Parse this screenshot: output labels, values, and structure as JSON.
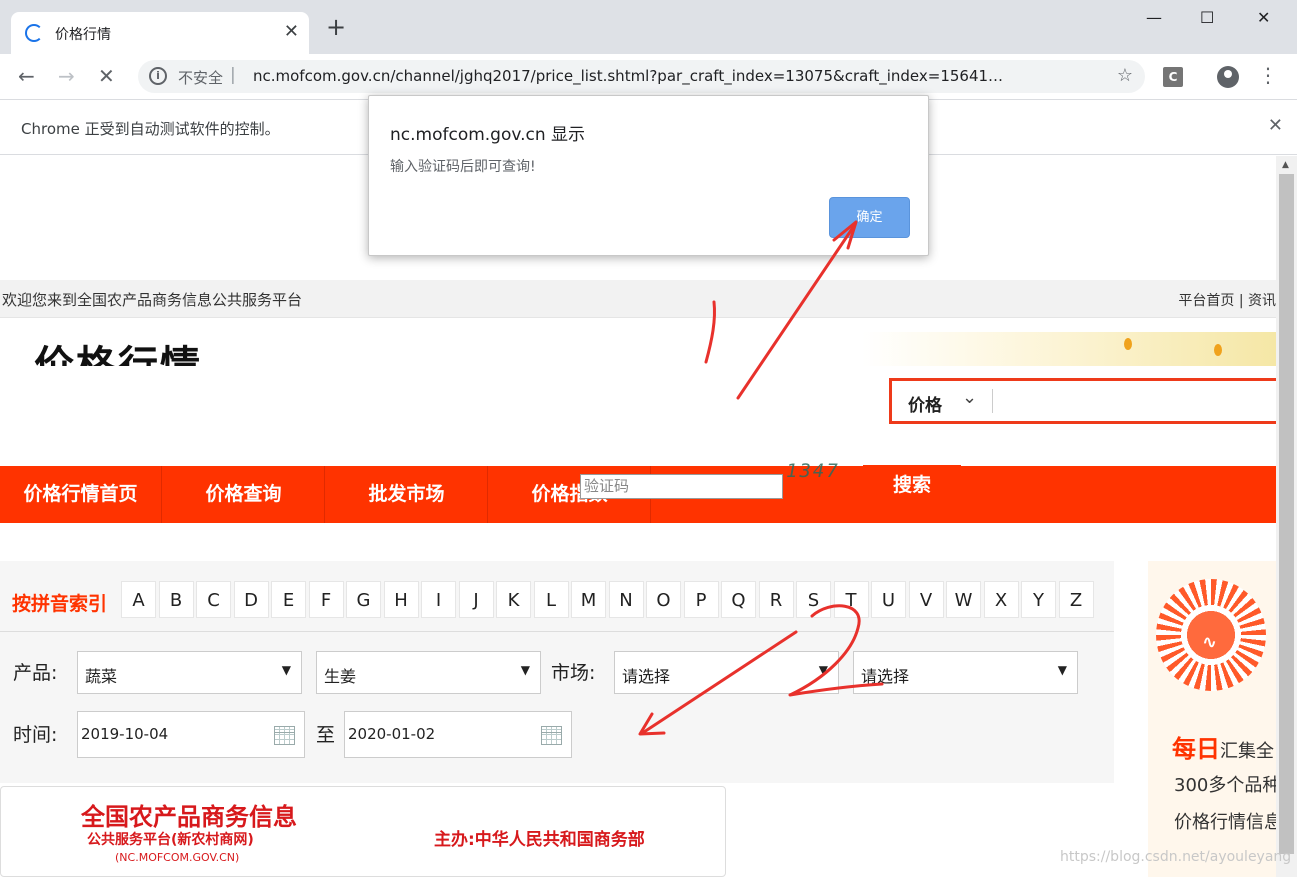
{
  "browser": {
    "tab_title": "价格行情",
    "new_tab": "+",
    "window_controls": {
      "minimize": "—",
      "maximize": "☐",
      "close": "✕"
    },
    "security_label": "不安全",
    "url": "nc.mofcom.gov.cn/channel/jghq2017/price_list.shtml?par_craft_index=13075&craft_index=15641…",
    "extension_letter": "C",
    "infobar_text": "Chrome 正受到自动测试软件的控制。"
  },
  "dialog": {
    "title": "nc.mofcom.gov.cn 显示",
    "message": "输入验证码后即可查询!",
    "ok_label": "确定"
  },
  "site": {
    "welcome": "欢迎您来到全国农产品商务信息公共服务平台",
    "top_links": "平台首页 | 资讯",
    "page_title": "价格行情",
    "search_type": "价格",
    "nav": [
      "价格行情首页",
      "价格查询",
      "批发市场",
      "价格指数"
    ]
  },
  "filter": {
    "pinyin_label": "按拼音索引",
    "letters": [
      "A",
      "B",
      "C",
      "D",
      "E",
      "F",
      "G",
      "H",
      "I",
      "J",
      "K",
      "L",
      "M",
      "N",
      "O",
      "P",
      "Q",
      "R",
      "S",
      "T",
      "U",
      "V",
      "W",
      "X",
      "Y",
      "Z"
    ],
    "product_label": "产品:",
    "product_category": "蔬菜",
    "product_item": "生姜",
    "market_label": "市场:",
    "market_region": "请选择",
    "market_name": "请选择",
    "time_label": "时间:",
    "date_from": "2019-10-04",
    "to_label": "至",
    "date_to": "2020-01-02",
    "captcha_placeholder": "验证码",
    "captcha_code": "1347",
    "search_label": "搜索"
  },
  "footer_logo": {
    "title": "全国农产品商务信息",
    "subtitle": "公共服务平台(新农村商网)",
    "domain": "(NC.MOFCOM.GOV.CN)",
    "host": "主办:中华人民共和国商务部"
  },
  "side": {
    "daily": "每日",
    "daily_rest": "汇集全",
    "line2": "300多个品种",
    "line3": "价格行情信息"
  },
  "annotations": {
    "mark1": "1",
    "mark2": "2"
  },
  "watermark": "https://blog.csdn.net/ayouleyang",
  "colors": {
    "brand_red": "#ff3300",
    "dialog_button": "#6aa4ec",
    "annotation": "#e8312c"
  }
}
